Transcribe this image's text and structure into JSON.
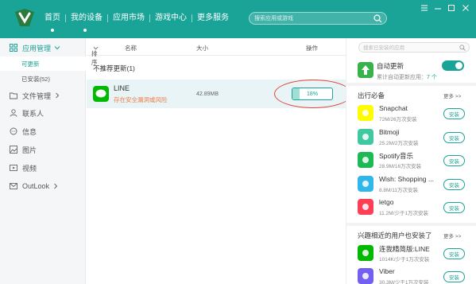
{
  "nav": {
    "items": [
      "首页",
      "我的设备",
      "应用市场",
      "游戏中心",
      "更多服务"
    ],
    "search_placeholder": "搜索应用或游戏"
  },
  "sidebar": {
    "app_manage": "应用管理",
    "sub_items": [
      "可更新",
      "已安装(52)"
    ],
    "items": [
      "文件管理",
      "联系人",
      "信息",
      "图片",
      "视频",
      "OutLook"
    ]
  },
  "list": {
    "headers": {
      "sort": "排序",
      "name": "名称",
      "size": "大小",
      "action": "操作"
    },
    "section_title": "不推荐更新(1)",
    "row": {
      "name": "LINE",
      "warning": "存在安全漏洞或风险",
      "size": "42.89MB",
      "progress_text": "18%",
      "progress_value": 0.18
    }
  },
  "right": {
    "search_placeholder": "搜索已安装的应用",
    "auto_update": {
      "title": "自动更新",
      "subtitle": "累计自动更新应用：",
      "count": "7 个",
      "enabled": true
    },
    "essentials": {
      "title": "出行必备",
      "more": "更多 >>",
      "apps": [
        {
          "name": "Snapchat",
          "stats": "72M/26万次安装",
          "button": "安装",
          "color": "#fffc00",
          "icon": "snapchat-icon"
        },
        {
          "name": "Bitmoji",
          "stats": "25.2M/2万次安装",
          "button": "安装",
          "color": "#40c8a0",
          "icon": "bitmoji-icon"
        },
        {
          "name": "Spotify音乐",
          "stats": "28.9M/16万次安装",
          "button": "安装",
          "color": "#1db954",
          "icon": "spotify-icon"
        },
        {
          "name": "Wish: Shopping ...",
          "stats": "8.8M/11万次安装",
          "button": "安装",
          "color": "#2fb7ec",
          "icon": "wish-icon"
        },
        {
          "name": "letgo",
          "stats": "11.2M/少于1万次安装",
          "button": "安装",
          "color": "#ff3f55",
          "icon": "letgo-icon"
        }
      ]
    },
    "similar": {
      "title": "兴趣相近的用户也安装了",
      "more": "更多 >>",
      "apps": [
        {
          "name": "连我精简版:LINE",
          "stats": "1014K/少于1万次安装",
          "button": "安装",
          "color": "#00b900",
          "icon": "line-lite-icon"
        },
        {
          "name": "Viber",
          "stats": "30.3M/少于1万次安装",
          "button": "安装",
          "color": "#7360f2",
          "icon": "viber-icon"
        }
      ]
    }
  },
  "colors": {
    "accent": "#1aa397",
    "warning": "#f07c4a",
    "highlight": "#e0433a"
  }
}
